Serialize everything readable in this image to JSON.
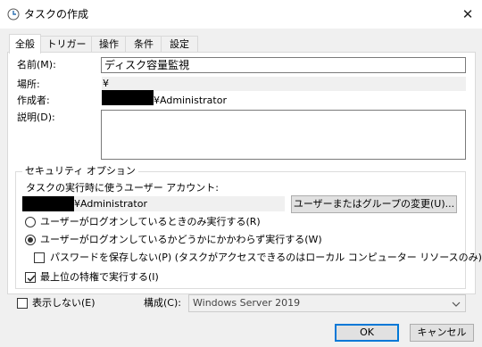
{
  "window": {
    "title": "タスクの作成",
    "close_glyph": "✕"
  },
  "tabs": [
    {
      "label": "全般",
      "active": true
    },
    {
      "label": "トリガー",
      "active": false
    },
    {
      "label": "操作",
      "active": false
    },
    {
      "label": "条件",
      "active": false
    },
    {
      "label": "設定",
      "active": false
    }
  ],
  "general": {
    "name_label": "名前(M):",
    "name_value": "ディスク容量監視",
    "location_label": "場所:",
    "location_value": "¥",
    "author_label": "作成者:",
    "author_value": "¥Administrator",
    "description_label": "説明(D):",
    "description_value": ""
  },
  "security": {
    "group_title": "セキュリティ オプション",
    "account_prompt": "タスクの実行時に使うユーザー アカウント:",
    "account_value": "¥Administrator",
    "change_button": "ユーザーまたはグループの変更(U)...",
    "radio_logged_on_only": "ユーザーがログオンしているときのみ実行する(R)",
    "radio_whether_logged_on": "ユーザーがログオンしているかどうかにかかわらず実行する(W)",
    "selected_radio": "whether_logged_on",
    "no_store_password": "パスワードを保存しない(P) (タスクがアクセスできるのはローカル コンピューター リソースのみ)",
    "no_store_password_checked": false,
    "highest_privileges": "最上位の特権で実行する(I)",
    "highest_privileges_checked": true
  },
  "bottom": {
    "hidden_label": "表示しない(E)",
    "hidden_checked": false,
    "configure_label": "構成(C):",
    "configure_value": "Windows Server 2019"
  },
  "buttons": {
    "ok": "OK",
    "cancel": "キャンセル"
  },
  "colors": {
    "accent": "#0078d7",
    "redaction": "#000000"
  }
}
